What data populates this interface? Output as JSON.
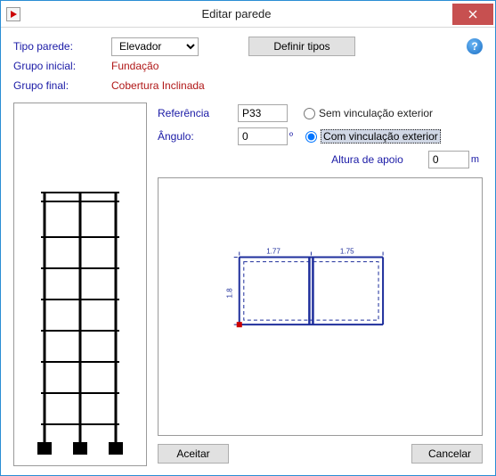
{
  "window": {
    "title": "Editar parede"
  },
  "top": {
    "tipo_parede_label": "Tipo parede:",
    "tipo_parede_value": "Elevador",
    "definir_tipos": "Definir tipos",
    "grupo_inicial_label": "Grupo inicial:",
    "grupo_inicial_value": "Fundação",
    "grupo_final_label": "Grupo final:",
    "grupo_final_value": "Cobertura Inclinada"
  },
  "form": {
    "referencia_label": "Referência",
    "referencia_value": "P33",
    "angulo_label": "Ângulo:",
    "angulo_value": "0",
    "angulo_unit": "º",
    "vinc_sem": "Sem vinculação exterior",
    "vinc_com": "Com vinculação exterior",
    "altura_apoio_label": "Altura de apoio",
    "altura_apoio_value": "0",
    "altura_apoio_unit": "m"
  },
  "buttons": {
    "ok": "Aceitar",
    "cancel": "Cancelar"
  },
  "elevation": {
    "floors": 8,
    "bays": 2,
    "beam_dims": [
      "1.77",
      "1.75"
    ],
    "wall_h": "1.8"
  }
}
